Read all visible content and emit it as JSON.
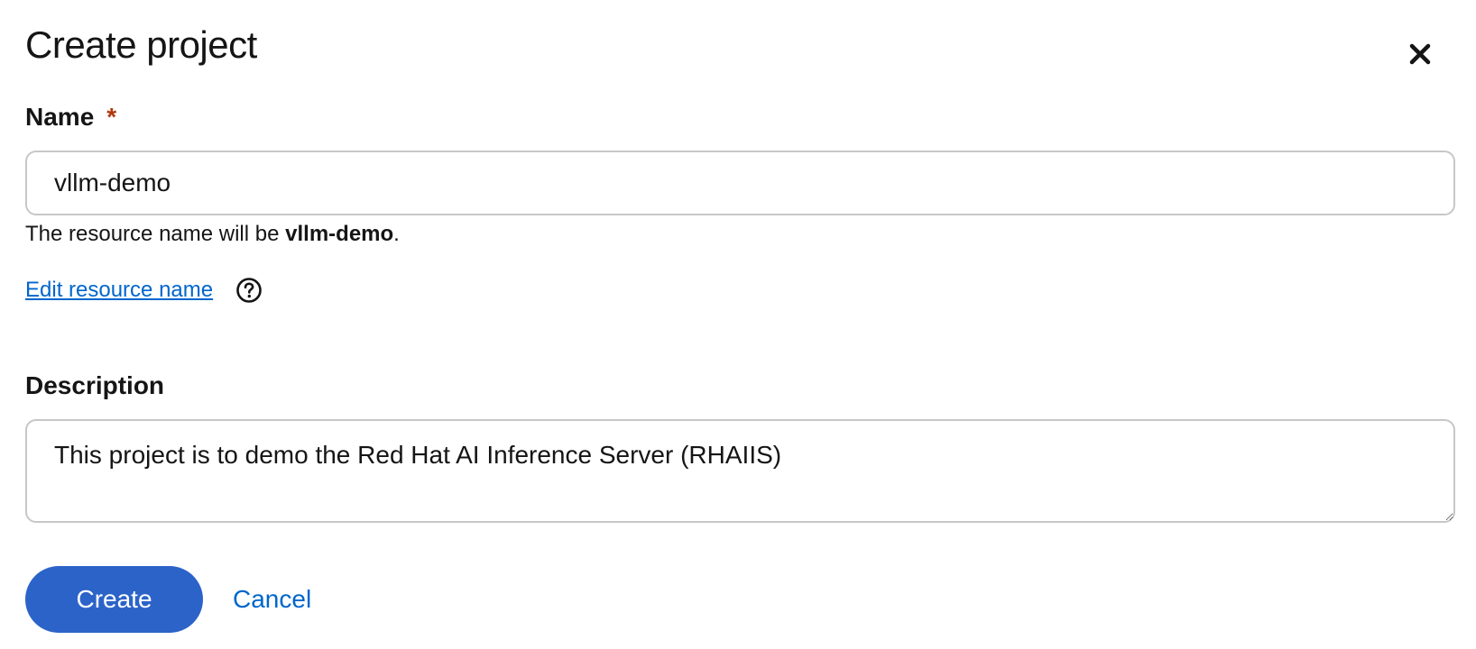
{
  "dialog": {
    "title": "Create project",
    "close_icon": "close-icon"
  },
  "name_field": {
    "label": "Name",
    "required_marker": "*",
    "value": "vllm-demo",
    "helper_prefix": "The resource name will be ",
    "helper_resource_name": "vllm-demo",
    "helper_suffix": "."
  },
  "edit_resource": {
    "link_label": "Edit resource name",
    "help_icon": "help-circle-icon"
  },
  "description_field": {
    "label": "Description",
    "value": "This project is to demo the Red Hat AI Inference Server (RHAIIS)"
  },
  "actions": {
    "create_label": "Create",
    "cancel_label": "Cancel"
  },
  "colors": {
    "primary": "#2b63c9",
    "link": "#0066cc",
    "required": "#b1380b",
    "border": "#c7c7c7",
    "text": "#151515"
  }
}
